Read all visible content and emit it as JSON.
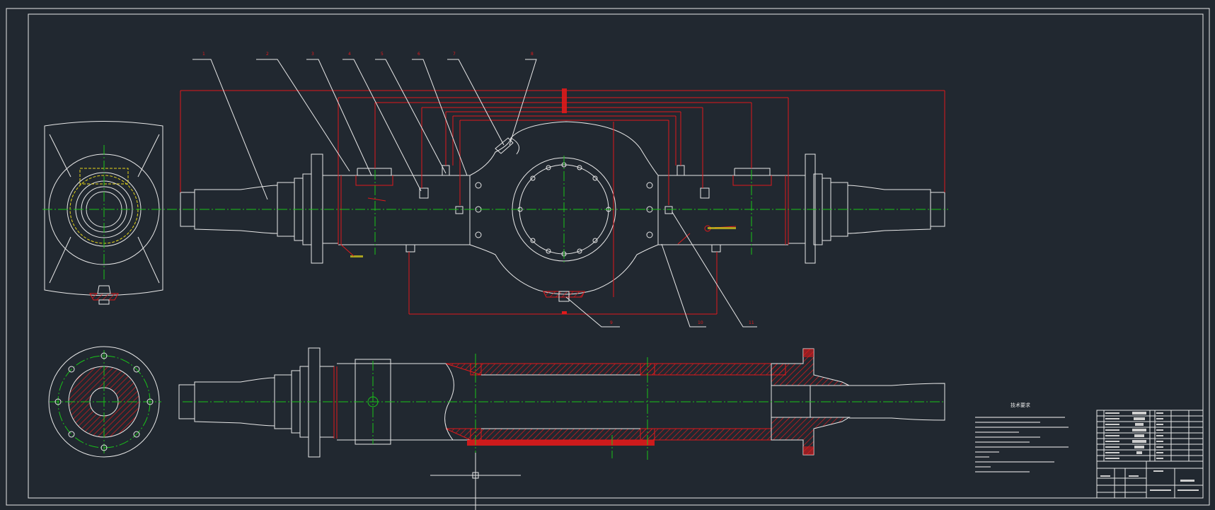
{
  "colors": {
    "background": "#212830",
    "outline": "#e8e8e8",
    "dimension": "#e0191b",
    "centerline": "#19c419",
    "hidden": "#e6d619"
  },
  "drawing": {
    "technical_requirements_title": "技术要求",
    "balloons_top": [
      "1",
      "2",
      "3",
      "4",
      "5",
      "6",
      "7",
      "8"
    ],
    "balloons_bottom": [
      "9",
      "10",
      "11"
    ]
  }
}
